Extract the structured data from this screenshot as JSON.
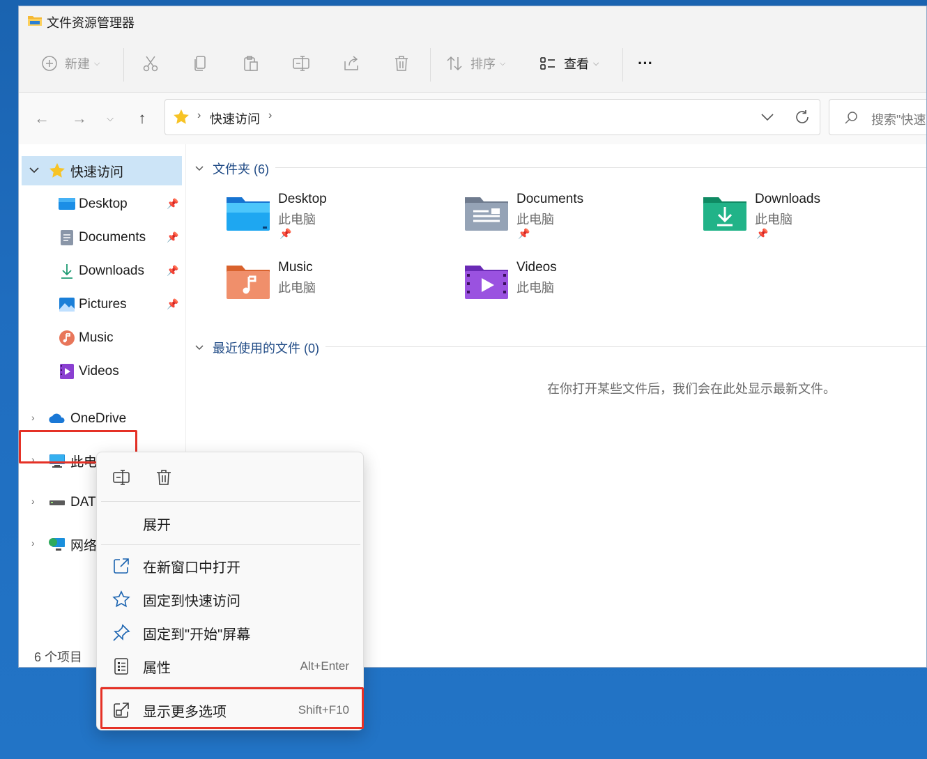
{
  "window": {
    "title": "文件资源管理器"
  },
  "toolbar": {
    "new_label": "新建",
    "sort_label": "排序",
    "view_label": "查看",
    "more_label": "···"
  },
  "address": {
    "crumb": "快速访问",
    "separator": "›",
    "search_placeholder": "搜索\"快速访问\""
  },
  "sidebar": {
    "quick_access": "快速访问",
    "items": [
      {
        "label": "Desktop"
      },
      {
        "label": "Documents"
      },
      {
        "label": "Downloads"
      },
      {
        "label": "Pictures"
      },
      {
        "label": "Music"
      },
      {
        "label": "Videos"
      }
    ],
    "onedrive": "OneDrive",
    "this_pc": "此电脑",
    "data_drive": "DAT",
    "network": "网络",
    "status": "6 个项目"
  },
  "content": {
    "folders_header": "文件夹 (6)",
    "recent_header": "最近使用的文件 (0)",
    "empty_message": "在你打开某些文件后，我们会在此处显示最新文件。",
    "folders": [
      {
        "name": "Desktop",
        "location": "此电脑"
      },
      {
        "name": "Documents",
        "location": "此电脑"
      },
      {
        "name": "Downloads",
        "location": "此电脑"
      },
      {
        "name": "Music",
        "location": "此电脑"
      },
      {
        "name": "Videos",
        "location": "此电脑"
      }
    ]
  },
  "context_menu": {
    "expand": "展开",
    "open_new_window": "在新窗口中打开",
    "pin_quick_access": "固定到快速访问",
    "pin_start": "固定到\"开始\"屏幕",
    "properties": "属性",
    "properties_shortcut": "Alt+Enter",
    "show_more": "显示更多选项",
    "show_more_shortcut": "Shift+F10"
  },
  "colors": {
    "accent": "#0067c0",
    "selection": "#cce4f7",
    "highlight": "#e53126",
    "desktop_bg": "#1f6dbf"
  }
}
